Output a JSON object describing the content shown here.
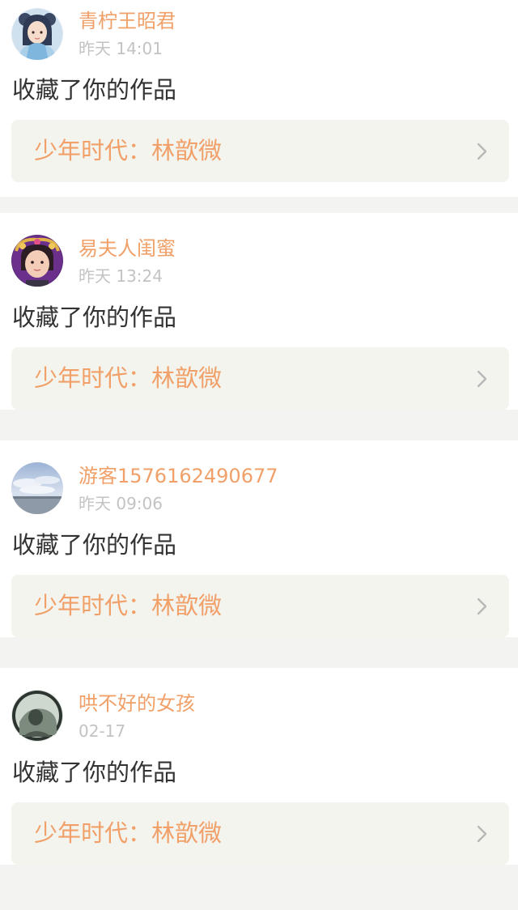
{
  "theme": {
    "accent": "#f0a068",
    "background": "#f3f3f1",
    "card": "#ffffff",
    "work_row": "#f4f4ef",
    "text": "#333333",
    "muted": "#c3c3c3"
  },
  "notifications": [
    {
      "user": "青柠王昭君",
      "time": "昨天 14:01",
      "action": "收藏了你的作品",
      "work_title": "少年时代：林歆微",
      "avatar_icon": "avatar-anime-girl-icon"
    },
    {
      "user": "易夫人闺蜜",
      "time": "昨天 13:24",
      "action": "收藏了你的作品",
      "work_title": "少年时代：林歆微",
      "avatar_icon": "avatar-girl-photo-icon"
    },
    {
      "user": "游客1576162490677",
      "time": "昨天 09:06",
      "action": "收藏了你的作品",
      "work_title": "少年时代：林歆微",
      "avatar_icon": "avatar-sky-landscape-icon"
    },
    {
      "user": "哄不好的女孩",
      "time": "02-17",
      "action": "收藏了你的作品",
      "work_title": "少年时代：林歆微",
      "avatar_icon": "avatar-portrait-icon"
    }
  ]
}
